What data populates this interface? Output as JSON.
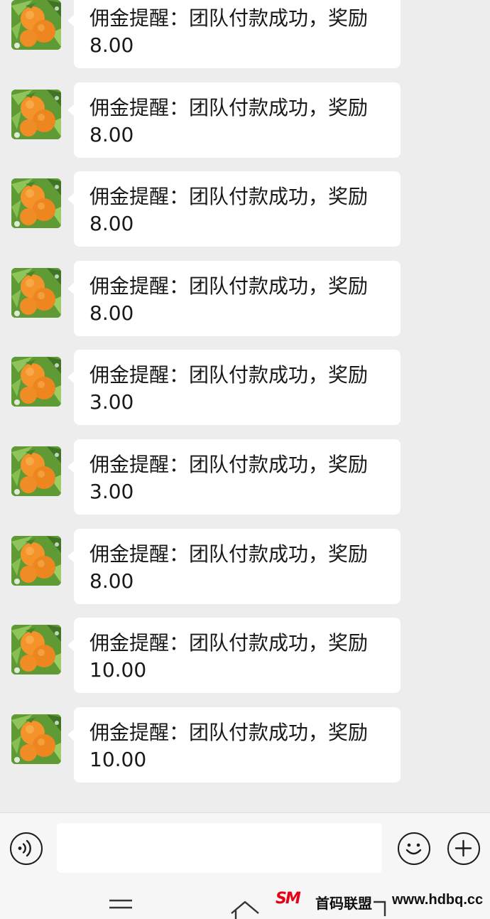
{
  "messages": [
    {
      "avatar_icon": "orange-fruit-avatar",
      "line1": "佣金提醒：团队付款成功，奖励",
      "line2": "8.00"
    },
    {
      "avatar_icon": "orange-fruit-avatar",
      "line1": "佣金提醒：团队付款成功，奖励",
      "line2": "8.00"
    },
    {
      "avatar_icon": "orange-fruit-avatar",
      "line1": "佣金提醒：团队付款成功，奖励",
      "line2": "8.00"
    },
    {
      "avatar_icon": "orange-fruit-avatar",
      "line1": "佣金提醒：团队付款成功，奖励",
      "line2": "8.00"
    },
    {
      "avatar_icon": "orange-fruit-avatar",
      "line1": "佣金提醒：团队付款成功，奖励",
      "line2": "3.00"
    },
    {
      "avatar_icon": "orange-fruit-avatar",
      "line1": "佣金提醒：团队付款成功，奖励",
      "line2": "3.00"
    },
    {
      "avatar_icon": "orange-fruit-avatar",
      "line1": "佣金提醒：团队付款成功，奖励",
      "line2": "8.00"
    },
    {
      "avatar_icon": "orange-fruit-avatar",
      "line1": "佣金提醒：团队付款成功，奖励",
      "line2": "10.00"
    },
    {
      "avatar_icon": "orange-fruit-avatar",
      "line1": "佣金提醒：团队付款成功，奖励",
      "line2": "10.00"
    }
  ],
  "input_bar": {
    "voice_icon": "voice-icon",
    "text_value": "",
    "emoji_icon": "emoji-icon",
    "plus_icon": "plus-icon"
  },
  "nav_bar": {
    "icons": [
      "menu-icon",
      "home-icon",
      "back-icon"
    ]
  },
  "watermark": {
    "logo": "SM",
    "text": "首码联盟",
    "url": "www.hdbq.cc"
  },
  "colors": {
    "chat_background": "#ededed",
    "bubble": "#ffffff",
    "text": "#191919",
    "watermark_logo": "#e60012"
  }
}
